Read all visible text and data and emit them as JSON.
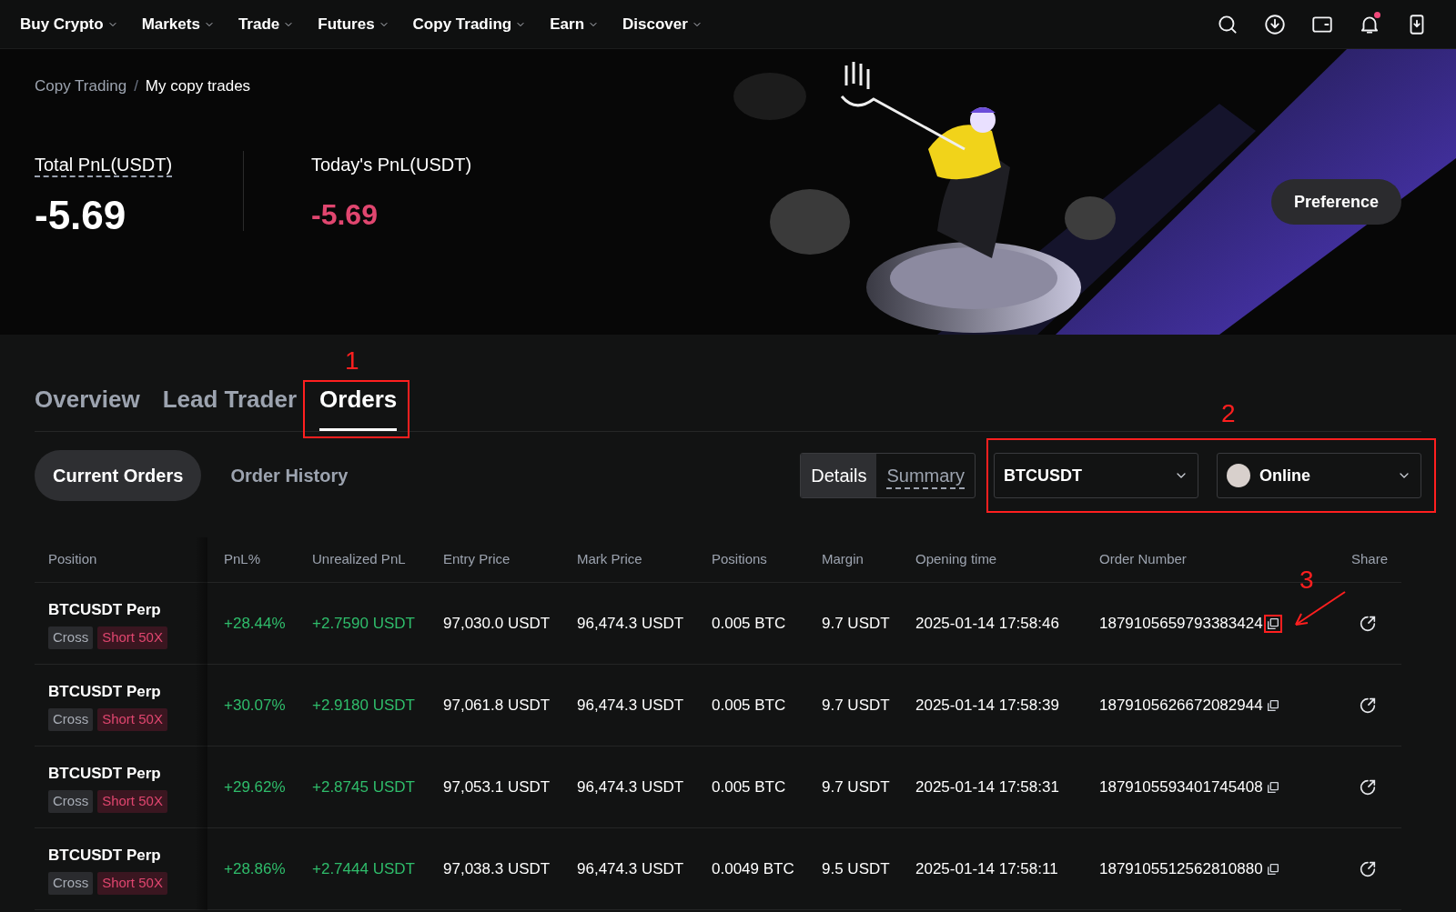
{
  "nav": {
    "items": [
      "Buy Crypto",
      "Markets",
      "Trade",
      "Futures",
      "Copy Trading",
      "Earn",
      "Discover"
    ],
    "notification_dot": {
      "color": "#f0487a"
    }
  },
  "hero": {
    "breadcrumb": [
      "Copy Trading",
      "My copy trades"
    ],
    "breadcrumb_separator": "/",
    "stats": [
      {
        "label": "Total PnL(USDT)",
        "value": "-5.69",
        "kind": "neutral",
        "dashed": true
      },
      {
        "label": "Today's PnL(USDT)",
        "value": "-5.69",
        "kind": "negative",
        "dashed": false
      }
    ],
    "preference_button": "Preference"
  },
  "tabs": [
    {
      "label": "Overview",
      "selected": false
    },
    {
      "label": "Lead Trader",
      "selected": false
    },
    {
      "label": "Orders",
      "selected": true
    }
  ],
  "order_tabs": [
    {
      "label": "Current Orders",
      "selected": true
    },
    {
      "label": "Order History",
      "selected": false
    }
  ],
  "view_toggle": [
    {
      "label": "Details",
      "selected": true
    },
    {
      "label": "Summary",
      "selected": false
    }
  ],
  "filters": [
    {
      "value": "BTCUSDT",
      "kind": "symbol"
    },
    {
      "value": "Online",
      "kind": "status"
    }
  ],
  "table": {
    "columns": [
      "Position",
      "PnL%",
      "Unrealized PnL",
      "Entry Price",
      "Mark Price",
      "Positions",
      "Margin",
      "Opening time",
      "Order Number",
      "Share"
    ],
    "rows": [
      {
        "position": "BTCUSDT Perp",
        "tags": [
          {
            "label": "Cross",
            "kind": "mode"
          },
          {
            "label": "Short 50X",
            "kind": "side"
          }
        ],
        "pnl_pct": "+28.44%",
        "unrealized_pnl": "+2.7590 USDT",
        "entry_price": "97,030.0 USDT",
        "mark_price": "96,474.3 USDT",
        "positions": "0.005 BTC",
        "margin": "9.7 USDT",
        "opening_time": "2025-01-14 17:58:46",
        "order_number": "1879105659793383424"
      },
      {
        "position": "BTCUSDT Perp",
        "tags": [
          {
            "label": "Cross",
            "kind": "mode"
          },
          {
            "label": "Short 50X",
            "kind": "side"
          }
        ],
        "pnl_pct": "+30.07%",
        "unrealized_pnl": "+2.9180 USDT",
        "entry_price": "97,061.8 USDT",
        "mark_price": "96,474.3 USDT",
        "positions": "0.005 BTC",
        "margin": "9.7 USDT",
        "opening_time": "2025-01-14 17:58:39",
        "order_number": "1879105626672082944"
      },
      {
        "position": "BTCUSDT Perp",
        "tags": [
          {
            "label": "Cross",
            "kind": "mode"
          },
          {
            "label": "Short 50X",
            "kind": "side"
          }
        ],
        "pnl_pct": "+29.62%",
        "unrealized_pnl": "+2.8745 USDT",
        "entry_price": "97,053.1 USDT",
        "mark_price": "96,474.3 USDT",
        "positions": "0.005 BTC",
        "margin": "9.7 USDT",
        "opening_time": "2025-01-14 17:58:31",
        "order_number": "1879105593401745408"
      },
      {
        "position": "BTCUSDT Perp",
        "tags": [
          {
            "label": "Cross",
            "kind": "mode"
          },
          {
            "label": "Short 50X",
            "kind": "side"
          }
        ],
        "pnl_pct": "+28.86%",
        "unrealized_pnl": "+2.7444 USDT",
        "entry_price": "97,038.3 USDT",
        "mark_price": "96,474.3 USDT",
        "positions": "0.0049 BTC",
        "margin": "9.5 USDT",
        "opening_time": "2025-01-14 17:58:11",
        "order_number": "1879105512562810880"
      }
    ]
  },
  "annotations": {
    "orders_tab": "1",
    "filters": "2",
    "copy_icon": "3"
  }
}
